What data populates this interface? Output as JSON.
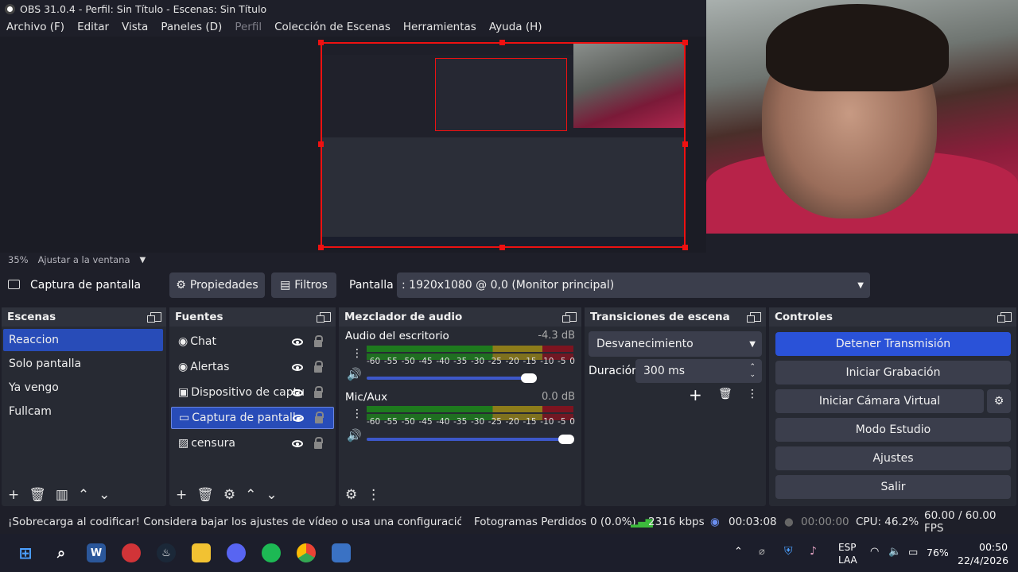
{
  "window_title": "OBS 31.0.4 - Perfil: Sin Título - Escenas: Sin Título",
  "menu": [
    "Archivo (F)",
    "Editar",
    "Vista",
    "Paneles (D)",
    "Perfil",
    "Colección de Escenas",
    "Herramientas",
    "Ayuda (H)"
  ],
  "zoom": {
    "value": "35%",
    "fit_label": "Ajustar a la ventana"
  },
  "source_bar": {
    "selected_source": "Captura de pantalla",
    "properties_label": "Propiedades",
    "filters_label": "Filtros",
    "display_label": "Pantalla",
    "display_value": ": 1920x1080 @ 0,0 (Monitor principal)"
  },
  "scenes": {
    "title": "Escenas",
    "items": [
      "Reaccion",
      "Solo pantalla",
      "Ya vengo",
      "Fullcam"
    ],
    "selected": "Reaccion"
  },
  "sources": {
    "title": "Fuentes",
    "items": [
      {
        "label": "Chat",
        "icon": "globe-icon"
      },
      {
        "label": "Alertas",
        "icon": "globe-icon"
      },
      {
        "label": "Dispositivo de captu",
        "icon": "camera-icon"
      },
      {
        "label": "Captura de pantalla",
        "icon": "monitor-icon"
      },
      {
        "label": "censura",
        "icon": "image-icon"
      }
    ],
    "selected": "Captura de pantalla"
  },
  "mixer": {
    "title": "Mezclador de audio",
    "channels": [
      {
        "name": "Audio del escritorio",
        "db": "-4.3 dB",
        "volume": 0.85
      },
      {
        "name": "Mic/Aux",
        "db": "0.0 dB",
        "volume": 1.0
      }
    ],
    "scale": [
      "-60",
      "-55",
      "-50",
      "-45",
      "-40",
      "-35",
      "-30",
      "-25",
      "-20",
      "-15",
      "-10",
      "-5",
      "0"
    ]
  },
  "transitions": {
    "title": "Transiciones de escena",
    "type": "Desvanecimiento",
    "duration_label": "Duración",
    "duration_value": "300 ms"
  },
  "controls": {
    "title": "Controles",
    "buttons": [
      "Detener Transmisión",
      "Iniciar Grabación",
      "Iniciar Cámara Virtual",
      "Modo Estudio",
      "Ajustes",
      "Salir"
    ]
  },
  "status": {
    "warning": "¡Sobrecarga al codificar! Considera bajar los ajustes de vídeo o usa una configuración del codifi",
    "dropped": "Fotogramas Perdidos 0 (0.0%)",
    "bitrate": "2316 kbps",
    "stream_time": "00:03:08",
    "rec_time": "00:00:00",
    "cpu": "CPU: 46.2%",
    "fps": "60.00 / 60.00 FPS"
  },
  "taskbar": {
    "lang": "ESP",
    "lang2": "LAA",
    "battery": "76%",
    "time": "00:50",
    "date": "22/4/2026"
  },
  "colors": {
    "accent": "#284cb8",
    "primary_button": "#2a52d8",
    "selection_border": "#ee1111"
  }
}
